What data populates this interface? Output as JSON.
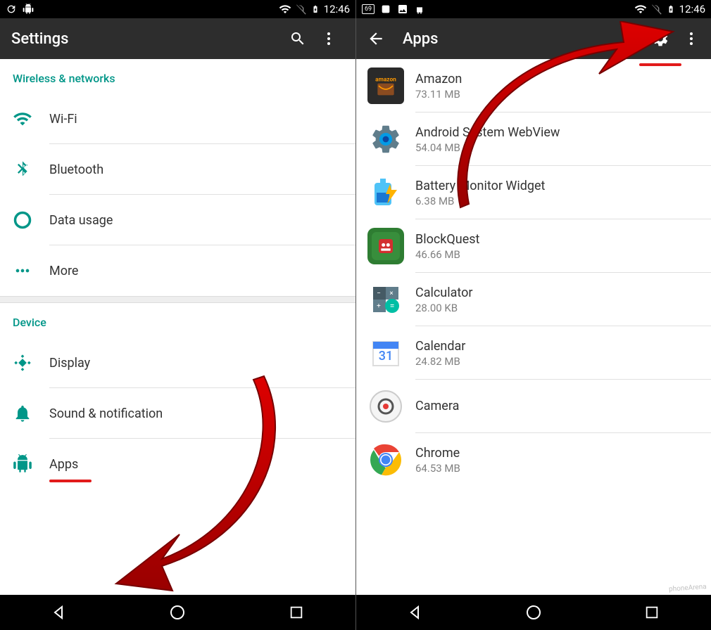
{
  "status": {
    "time": "12:46"
  },
  "left": {
    "title": "Settings",
    "sections": [
      {
        "header": "Wireless & networks",
        "items": [
          {
            "label": "Wi-Fi",
            "icon": "wifi"
          },
          {
            "label": "Bluetooth",
            "icon": "bluetooth"
          },
          {
            "label": "Data usage",
            "icon": "data"
          },
          {
            "label": "More",
            "icon": "more"
          }
        ]
      },
      {
        "header": "Device",
        "items": [
          {
            "label": "Display",
            "icon": "display"
          },
          {
            "label": "Sound & notification",
            "icon": "sound"
          },
          {
            "label": "Apps",
            "icon": "apps"
          }
        ]
      }
    ]
  },
  "right": {
    "title": "Apps",
    "apps": [
      {
        "name": "Amazon",
        "size": "73.11 MB",
        "icon": "amazon"
      },
      {
        "name": "Android System WebView",
        "size": "54.04 MB",
        "icon": "webview"
      },
      {
        "name": "Battery Monitor Widget",
        "size": "6.38 MB",
        "icon": "battery"
      },
      {
        "name": "BlockQuest",
        "size": "46.66 MB",
        "icon": "blockquest"
      },
      {
        "name": "Calculator",
        "size": "28.00 KB",
        "icon": "calculator"
      },
      {
        "name": "Calendar",
        "size": "24.82 MB",
        "icon": "calendar"
      },
      {
        "name": "Camera",
        "size": "",
        "icon": "camera"
      },
      {
        "name": "Chrome",
        "size": "64.53 MB",
        "icon": "chrome"
      }
    ]
  },
  "watermark": "phoneArena"
}
